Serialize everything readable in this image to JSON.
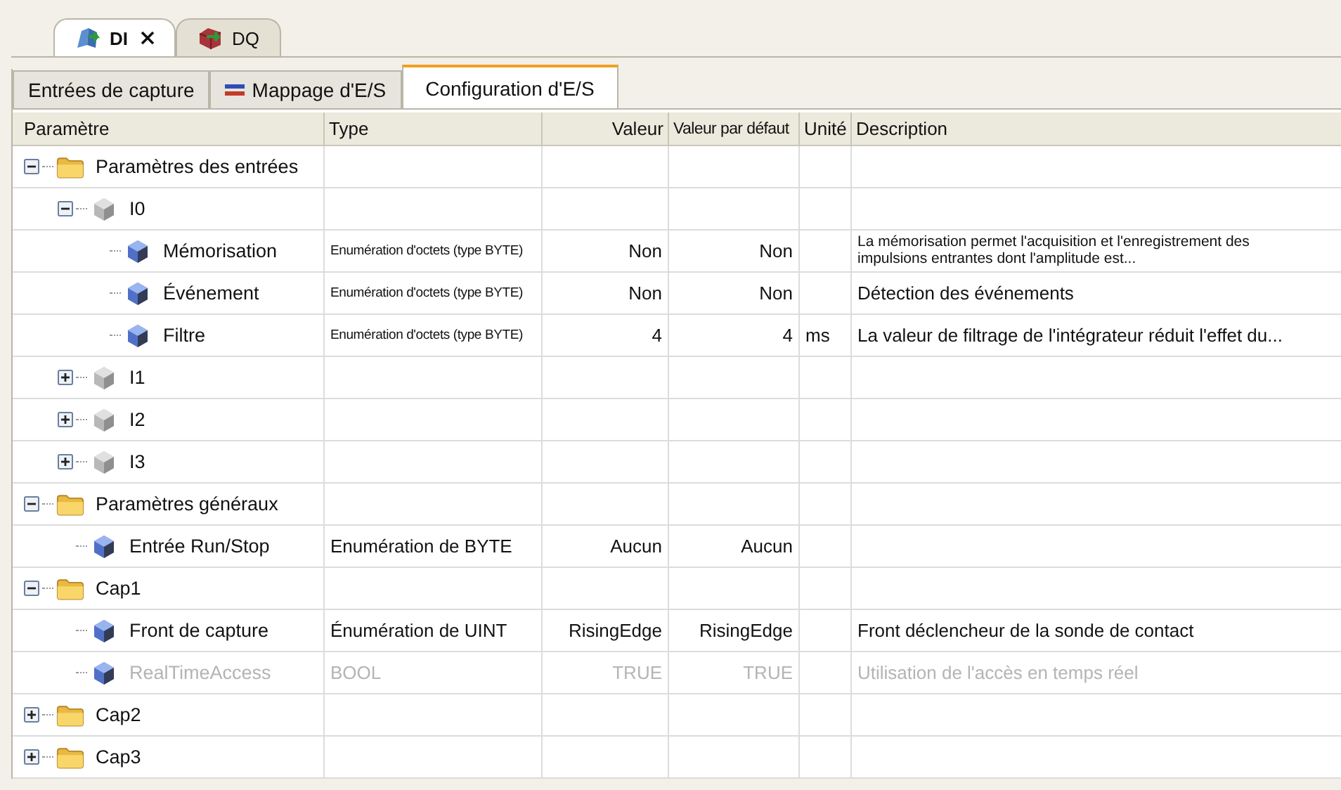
{
  "editor_tabs": [
    {
      "label": "DI",
      "selected": true,
      "closable": true,
      "kind": "input"
    },
    {
      "label": "DQ",
      "selected": false,
      "closable": false,
      "kind": "output"
    }
  ],
  "tabs": [
    {
      "label": "Entrées de capture",
      "selected": false,
      "icon": false
    },
    {
      "label": "Mappage d'E/S",
      "selected": false,
      "icon": true
    },
    {
      "label": "Configuration d'E/S",
      "selected": true,
      "icon": false
    }
  ],
  "table": {
    "columns": [
      "Paramètre",
      "Type",
      "Valeur",
      "Valeur par défaut",
      "Unité",
      "Description"
    ],
    "rows": [
      {
        "label": "Paramètres des entrées",
        "kind": "folder",
        "expanded": true,
        "children": [
          {
            "label": "I0",
            "kind": "channel",
            "expanded": true,
            "children": [
              {
                "label": "Mémorisation",
                "kind": "param",
                "type": "Enumération d'octets (type BYTE)",
                "type_compact": true,
                "value": "Non",
                "default": "Non",
                "description": "La mémorisation permet l'acquisition et l'enregistrement des impulsions entrantes dont l'amplitude est...",
                "description_compact": true,
                "disabled": false
              },
              {
                "label": "Événement",
                "kind": "param",
                "type": "Enumération d'octets (type BYTE)",
                "type_compact": true,
                "value": "Non",
                "default": "Non",
                "description": "Détection des événements",
                "disabled": false
              },
              {
                "label": "Filtre",
                "kind": "param",
                "type": "Enumération d'octets (type BYTE)",
                "type_compact": true,
                "value": "4",
                "default": "4",
                "unit": "ms",
                "description": "La valeur de filtrage de l'intégrateur réduit l'effet du...",
                "disabled": false
              }
            ]
          },
          {
            "label": "I1",
            "kind": "channel",
            "expanded": false
          },
          {
            "label": "I2",
            "kind": "channel",
            "expanded": false
          },
          {
            "label": "I3",
            "kind": "channel",
            "expanded": false
          }
        ]
      },
      {
        "label": "Paramètres généraux",
        "kind": "folder",
        "expanded": true,
        "children": [
          {
            "label": "Entrée Run/Stop",
            "kind": "param",
            "type": "Enumération de BYTE",
            "value": "Aucun",
            "default": "Aucun",
            "disabled": false
          }
        ]
      },
      {
        "label": "Cap1",
        "kind": "folder",
        "expanded": true,
        "children": [
          {
            "label": "Front de capture",
            "kind": "param",
            "type": "Énumération de UINT",
            "value": "RisingEdge",
            "default": "RisingEdge",
            "description": "Front déclencheur de la sonde de contact",
            "disabled": false
          },
          {
            "label": "RealTimeAccess",
            "kind": "param",
            "type": "BOOL",
            "value": "TRUE",
            "default": "TRUE",
            "description": "Utilisation de l'accès en temps réel",
            "disabled": true
          }
        ]
      },
      {
        "label": "Cap2",
        "kind": "folder",
        "expanded": false
      },
      {
        "label": "Cap3",
        "kind": "folder",
        "expanded": false
      }
    ]
  }
}
